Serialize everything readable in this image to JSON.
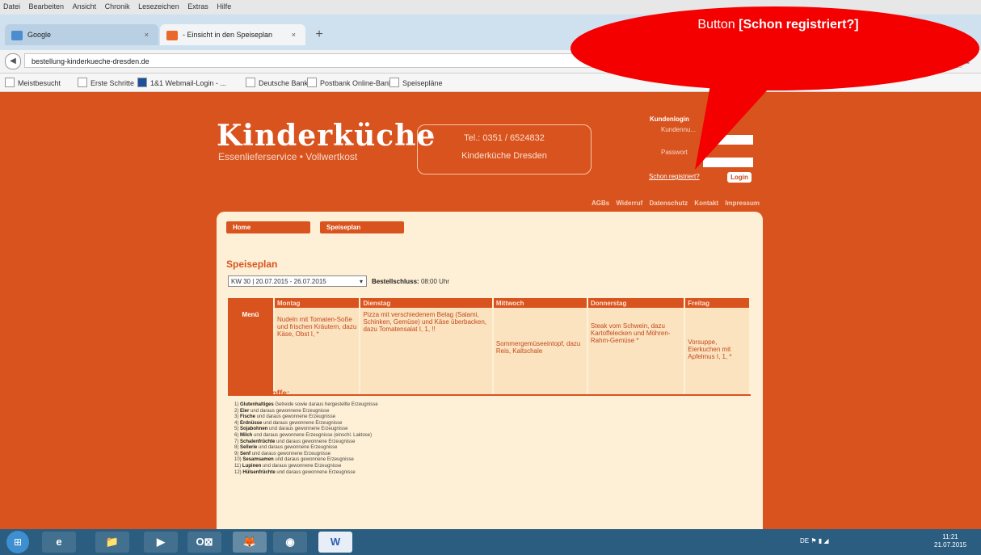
{
  "browser": {
    "menu": [
      "Datei",
      "Bearbeiten",
      "Ansicht",
      "Chronik",
      "Lesezeichen",
      "Extras",
      "Hilfe"
    ],
    "tabs": [
      {
        "label": "Google",
        "color": "#4a8ed0"
      },
      {
        "label": "- Einsicht in den Speiseplan",
        "color": "#e9692c"
      }
    ],
    "url": "bestellung-kinderkueche-dresden.de",
    "bookmarks": [
      "Meistbesucht",
      "Erste Schritte",
      "1&1 Webmail-Login - ...",
      "Deutsche Banke",
      "Postbank Online-Bank...",
      "Speisepläne"
    ]
  },
  "header": {
    "logo": "Kinderküche",
    "tagline": "Essenlieferservice • Vollwertkost",
    "phone": "Tel.: 0351 / 6524832",
    "company": "Kinderküche Dresden"
  },
  "login": {
    "title": "Kundenlogin",
    "customer_label": "Kundennu...",
    "password_label": "Passwort",
    "register_link": "Schon registriert?",
    "login_button": "Login"
  },
  "top_nav": [
    "AGBs",
    "Widerruf",
    "Datenschutz",
    "Kontakt",
    "Impressum"
  ],
  "page_nav": {
    "home": "Home",
    "speiseplan": "Speiseplan"
  },
  "speiseplan": {
    "title": "Speiseplan",
    "week": "KW 30 | 20.07.2015 - 26.07.2015",
    "deadline_label": "Bestellschluss:",
    "deadline_value": "08:00 Uhr",
    "corner": "Menü",
    "days": [
      "Montag",
      "Dienstag",
      "Mittwoch",
      "Donnerstag",
      "Freitag"
    ],
    "meals": [
      "Nudeln mit Tomaten-Soße und frischen Kräutern, dazu Käse, Obst I, *",
      "Pizza mit verschiedenem Belag (Salami, Schinken, Gemüse) und Käse überbacken, dazu Tomatensalat I, 1, !!",
      "Sommergemüseeintopf, dazu Reis, Kaltschale",
      "Steak vom Schwein, dazu Kartoffelecken und Möhren-Rahm-Gemüse *",
      "Vorsuppe, Eierkuchen mit Apfelmus I, 1, *"
    ]
  },
  "zusatzstoffe": {
    "title": "Zusatzstoffe:",
    "items": [
      {
        "num": "1)",
        "name": "Glutenhaltiges",
        "rest": "Getreide sowie daraus hergestellte Erzeugnisse"
      },
      {
        "num": "2)",
        "name": "Eier",
        "rest": "und daraus gewonnene Erzeugnisse"
      },
      {
        "num": "3)",
        "name": "Fische",
        "rest": "und daraus gewonnene Erzeugnisse"
      },
      {
        "num": "4)",
        "name": "Erdnüsse",
        "rest": "und daraus gewonnene Erzeugnisse"
      },
      {
        "num": "5)",
        "name": "Sojabohnen",
        "rest": "und daraus gewonnene Erzeugnisse"
      },
      {
        "num": "6)",
        "name": "Milch",
        "rest": "und daraus gewonnene Erzeugnisse (einschl. Laktose)"
      },
      {
        "num": "7)",
        "name": "Schalenfrüchte",
        "rest": "und daraus gewonnene Erzeugnisse"
      },
      {
        "num": "8)",
        "name": "Sellerie",
        "rest": "und daraus gewonnene Erzeugnisse"
      },
      {
        "num": "9)",
        "name": "Senf",
        "rest": "und daraus gewonnene Erzeugnisse"
      },
      {
        "num": "10)",
        "name": "Sesamsamen",
        "rest": "und daraus gewonnene Erzeugnisse"
      },
      {
        "num": "11)",
        "name": "Lupinen",
        "rest": "und daraus gewonnene Erzeugnisse"
      },
      {
        "num": "12)",
        "name": "Hülsenfrüchte",
        "rest": "und daraus gewonnene Erzeugnisse"
      }
    ]
  },
  "callout": {
    "prefix": "Button ",
    "emphasis": "[Schon registriert?]"
  },
  "taskbar": {
    "apps": [
      "e",
      "📁",
      "▶",
      "O⊠",
      "🦊",
      "◉",
      "W"
    ],
    "tray": "DE",
    "time": "11:21",
    "date": "21.07.2015"
  },
  "colors": {
    "brand": "#d9531e",
    "panel": "#fdf0d6",
    "callout": "#f40000"
  }
}
